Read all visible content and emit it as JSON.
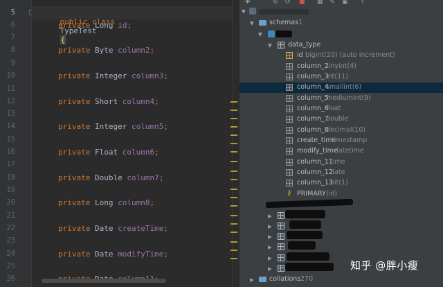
{
  "editor": {
    "line_numbers": [
      "5",
      "6",
      "7",
      "8",
      "9",
      "10",
      "11",
      "12",
      "13",
      "14",
      "15",
      "16",
      "17",
      "18",
      "19",
      "20",
      "21",
      "22",
      "23",
      "24",
      "25",
      "26"
    ],
    "current_line": "5",
    "lines": [
      {
        "kw": "public class",
        "name": "TypeTest",
        "brace": "{"
      },
      {
        "kw": "private",
        "type": "Long",
        "field": "id"
      },
      {
        "kw": "private",
        "type": "Byte",
        "field": "column2"
      },
      {
        "kw": "private",
        "type": "Integer",
        "field": "column3"
      },
      {
        "kw": "private",
        "type": "Short",
        "field": "column4"
      },
      {
        "kw": "private",
        "type": "Integer",
        "field": "column5"
      },
      {
        "kw": "private",
        "type": "Float",
        "field": "column6"
      },
      {
        "kw": "private",
        "type": "Double",
        "field": "column7"
      },
      {
        "kw": "private",
        "type": "Long",
        "field": "column8"
      },
      {
        "kw": "private",
        "type": "Date",
        "field": "createTime"
      },
      {
        "kw": "private",
        "type": "Date",
        "field": "modifyTime"
      },
      {
        "kw": "private",
        "type": "Date",
        "field": "column11"
      }
    ]
  },
  "tree": {
    "schemas": {
      "label": "schemas",
      "count": "1"
    },
    "table": {
      "label": "data_type"
    },
    "columns": [
      {
        "name": "id",
        "type": "bigint(20) (auto increment)"
      },
      {
        "name": "column_2",
        "type": "tinyint(4)"
      },
      {
        "name": "column_3",
        "type": "int(11)"
      },
      {
        "name": "column_4",
        "type": "smallint(6)"
      },
      {
        "name": "column_5",
        "type": "mediumint(9)"
      },
      {
        "name": "column_6",
        "type": "float"
      },
      {
        "name": "column_7",
        "type": "double"
      },
      {
        "name": "column_8",
        "type": "decimal(10)"
      },
      {
        "name": "create_time",
        "type": "timestamp"
      },
      {
        "name": "modify_time",
        "type": "datetime"
      },
      {
        "name": "column_11",
        "type": "time"
      },
      {
        "name": "column_12",
        "type": "date"
      },
      {
        "name": "column_13",
        "type": "bit(1)"
      }
    ],
    "primary_key": {
      "name": "PRIMARY",
      "cols": "(id)"
    },
    "collations": {
      "label": "collations",
      "count": "270"
    },
    "selected_column": "column_4"
  },
  "watermark": "知乎 @胖小瘦",
  "colors": {
    "accent_selection": "#0d293e",
    "keyword": "#cc7832",
    "field": "#9876aa",
    "key_icon": "#e3a82c"
  }
}
